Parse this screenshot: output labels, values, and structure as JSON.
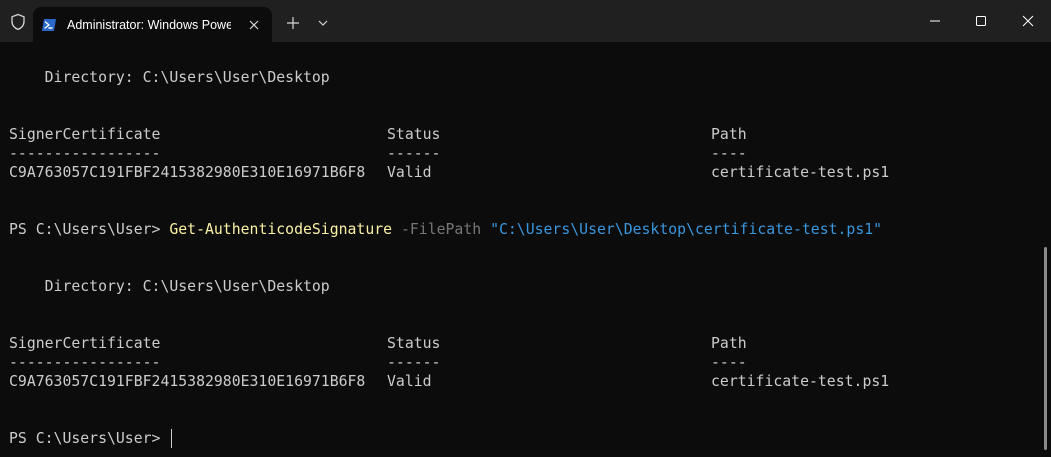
{
  "titlebar": {
    "tab_title": "Administrator: Windows PowerShell",
    "icons": {
      "shield": "shield-icon",
      "tab_icon": "powershell-icon",
      "tab_close": "close-icon",
      "new_tab": "plus-icon",
      "dropdown": "chevron-down-icon",
      "minimize": "minimize-icon",
      "maximize": "maximize-icon",
      "close": "close-icon"
    }
  },
  "terminal": {
    "block1": {
      "directory": "    Directory: C:\\Users\\User\\Desktop",
      "headers": [
        "SignerCertificate",
        "Status",
        "Path"
      ],
      "underlines": [
        "-----------------",
        "------",
        "----"
      ],
      "row": [
        "C9A763057C191FBF2415382980E310E16971B6F8",
        "Valid",
        "certificate-test.ps1"
      ]
    },
    "command": {
      "prompt": "PS C:\\Users\\User> ",
      "cmdlet": "Get-AuthenticodeSignature",
      "param": " -FilePath ",
      "value": "\"C:\\Users\\User\\Desktop\\certificate-test.ps1\""
    },
    "block2": {
      "directory": "    Directory: C:\\Users\\User\\Desktop",
      "headers": [
        "SignerCertificate",
        "Status",
        "Path"
      ],
      "underlines": [
        "-----------------",
        "------",
        "----"
      ],
      "row": [
        "C9A763057C191FBF2415382980E310E16971B6F8",
        "Valid",
        "certificate-test.ps1"
      ]
    },
    "final_prompt": "PS C:\\Users\\User> "
  },
  "colors": {
    "background": "#0c0c0c",
    "titlebar": "#202020",
    "foreground": "#cccccc",
    "cmdlet": "#f9f1a5",
    "parameter": "#767676",
    "string": "#3a96dd"
  }
}
